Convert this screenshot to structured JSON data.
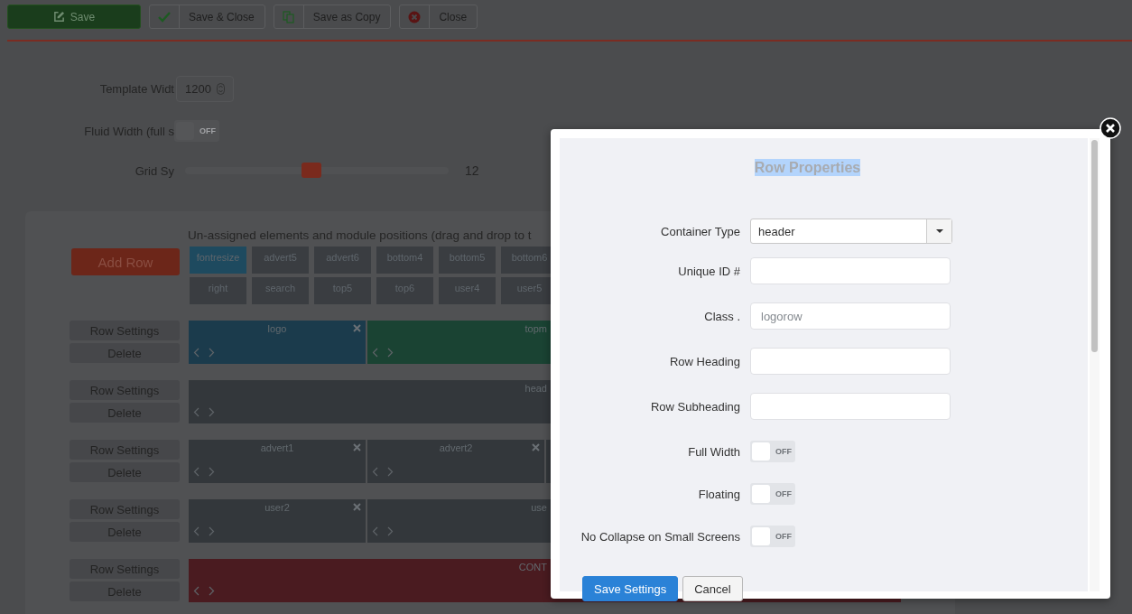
{
  "toolbar": [
    {
      "label": "Save",
      "kind": "save"
    },
    {
      "label": "Save & Close",
      "kind": "check"
    },
    {
      "label": "Save as Copy",
      "kind": "copy"
    },
    {
      "label": "Close",
      "kind": "close"
    }
  ],
  "settings": {
    "template_width": {
      "label": "Template Widt",
      "value": "1200"
    },
    "fluid_width": {
      "label": "Fluid Width (full s",
      "on": false,
      "state_label": "OFF"
    },
    "grid_system": {
      "label": "Grid Sy",
      "level": 0.48,
      "reading": "12"
    }
  },
  "layout": {
    "add_row": "Add Row",
    "heading": "Un-assigned elements and module positions (drag and drop to t",
    "positions": [
      {
        "label": "fontresize",
        "color": "#1e4a5f"
      },
      {
        "label": "advert5",
        "color": "#3a3d41"
      },
      {
        "label": "advert6",
        "color": "#3a3d41"
      },
      {
        "label": "bottom4",
        "color": "#3a3d41"
      },
      {
        "label": "bottom5",
        "color": "#3a3d41"
      },
      {
        "label": "bottom6",
        "color": "#3a3d41"
      },
      {
        "label": "right",
        "color": "#3a3d41"
      },
      {
        "label": "search",
        "color": "#3a3d41"
      },
      {
        "label": "top5",
        "color": "#3a3d41"
      },
      {
        "label": "top6",
        "color": "#3a3d41"
      },
      {
        "label": "user4",
        "color": "#3a3d41"
      },
      {
        "label": "user5",
        "color": "#3a3d41"
      }
    ],
    "rows": [
      {
        "settings": "Row Settings",
        "delete": "Delete",
        "blocks": [
          {
            "label": "logo",
            "color": "#1b3b4c",
            "closable": true
          },
          {
            "label": "topm",
            "color": "#1a4333"
          }
        ]
      },
      {
        "settings": "Row Settings",
        "delete": "Delete",
        "blocks": [
          {
            "label": "head",
            "color": "#33373b"
          }
        ]
      },
      {
        "settings": "Row Settings",
        "delete": "Delete",
        "blocks": [
          {
            "label": "advert1",
            "color": "#33373b",
            "closable": true
          },
          {
            "label": "advert2",
            "color": "#33373b",
            "closable": true
          },
          {
            "color": "#33373b"
          }
        ]
      },
      {
        "settings": "Row Settings",
        "delete": "Delete",
        "blocks": [
          {
            "label": "user2",
            "color": "#33373b",
            "closable": true
          },
          {
            "label": "use",
            "color": "#33373b"
          }
        ]
      },
      {
        "settings": "Row Settings",
        "delete": "Delete",
        "blocks": [
          {
            "label": "CONT",
            "color": "#4a1b20"
          }
        ]
      }
    ]
  },
  "modal": {
    "title": "Row Properties",
    "title_selected": true,
    "fields": [
      {
        "kind": "select",
        "label": "Container Type",
        "value": "header"
      },
      {
        "kind": "text",
        "label": "Unique ID #"
      },
      {
        "kind": "text",
        "label": "Class .",
        "placeholder": "logorow"
      },
      {
        "kind": "text",
        "label": "Row Heading"
      },
      {
        "kind": "text",
        "label": "Row Subheading"
      },
      {
        "kind": "toggle",
        "label": "Full Width",
        "on": false,
        "state_label": "OFF"
      },
      {
        "kind": "toggle",
        "label": "Floating",
        "on": false,
        "state_label": "OFF"
      },
      {
        "kind": "toggle",
        "label": "No Collapse on Small Screens",
        "on": false,
        "state_label": "OFF"
      }
    ],
    "buttons": [
      {
        "label": "Save Settings",
        "kind": "primary"
      },
      {
        "label": "Cancel",
        "kind": "default"
      }
    ]
  }
}
